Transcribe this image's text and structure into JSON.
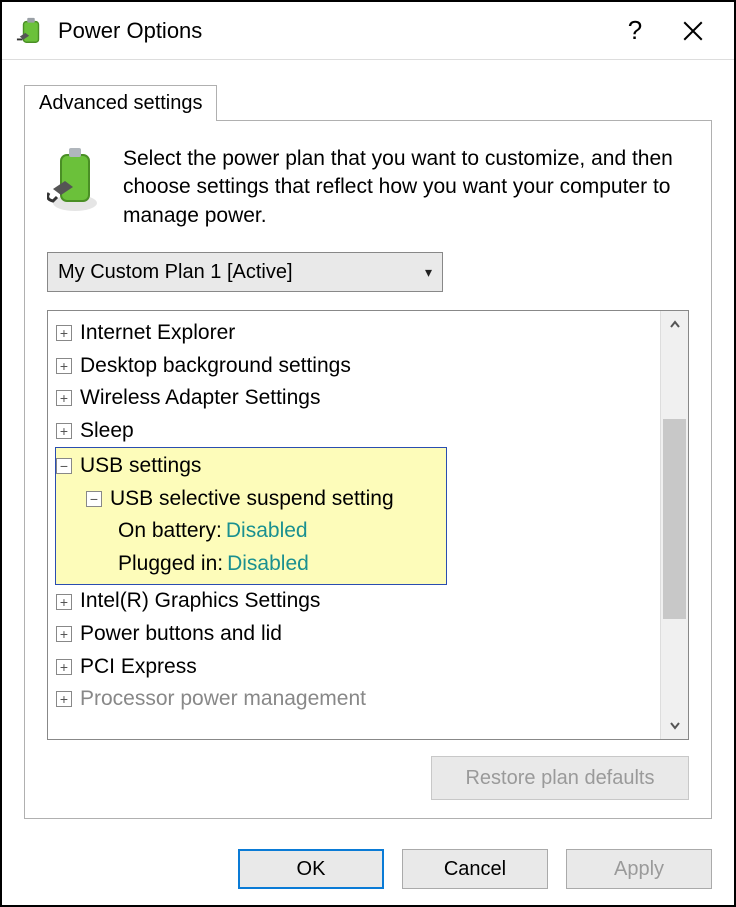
{
  "window": {
    "title": "Power Options"
  },
  "tab": {
    "label": "Advanced settings"
  },
  "intro": "Select the power plan that you want to customize, and then choose settings that reflect how you want your computer to manage power.",
  "plan_select": {
    "value": "My Custom Plan 1 [Active]"
  },
  "tree": {
    "items": [
      "Internet Explorer",
      "Desktop background settings",
      "Wireless Adapter Settings",
      "Sleep"
    ],
    "usb": {
      "label": "USB settings",
      "child_label": "USB selective suspend setting",
      "on_battery_label": "On battery:",
      "on_battery_value": "Disabled",
      "plugged_in_label": "Plugged in:",
      "plugged_in_value": "Disabled"
    },
    "items_after": [
      "Intel(R) Graphics Settings",
      "Power buttons and lid",
      "PCI Express"
    ],
    "truncated": "Processor power management"
  },
  "restore_label": "Restore plan defaults",
  "buttons": {
    "ok": "OK",
    "cancel": "Cancel",
    "apply": "Apply"
  }
}
